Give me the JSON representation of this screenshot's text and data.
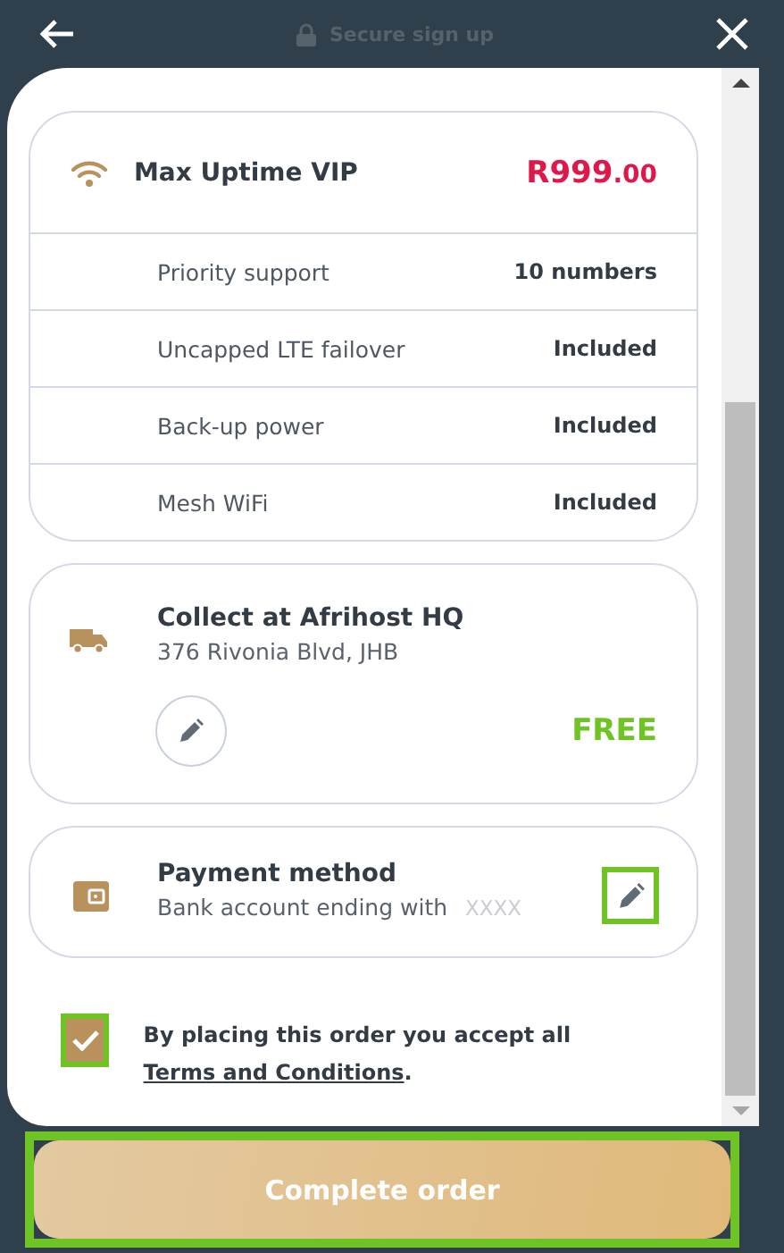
{
  "header": {
    "title": "Secure sign up"
  },
  "plan": {
    "name": "Max Uptime VIP",
    "price": "R999",
    "price_cents": ".00",
    "features": [
      {
        "label": "Priority support",
        "value": "10 numbers"
      },
      {
        "label": "Uncapped LTE failover",
        "value": "Included"
      },
      {
        "label": "Back-up power",
        "value": "Included"
      },
      {
        "label": "Mesh WiFi",
        "value": "Included"
      }
    ]
  },
  "delivery": {
    "title": "Collect at Afrihost HQ",
    "address": "376 Rivonia Blvd, JHB",
    "price": "FREE"
  },
  "payment": {
    "title": "Payment method",
    "detail": "Bank account ending with",
    "account": "XXXX",
    "edit_highlighted": true
  },
  "terms": {
    "checked": true,
    "highlighted": true,
    "text": "By placing this order you accept all",
    "link": "Terms and Conditions",
    "after": "."
  },
  "submit": {
    "label": "Complete order",
    "highlighted": true
  }
}
